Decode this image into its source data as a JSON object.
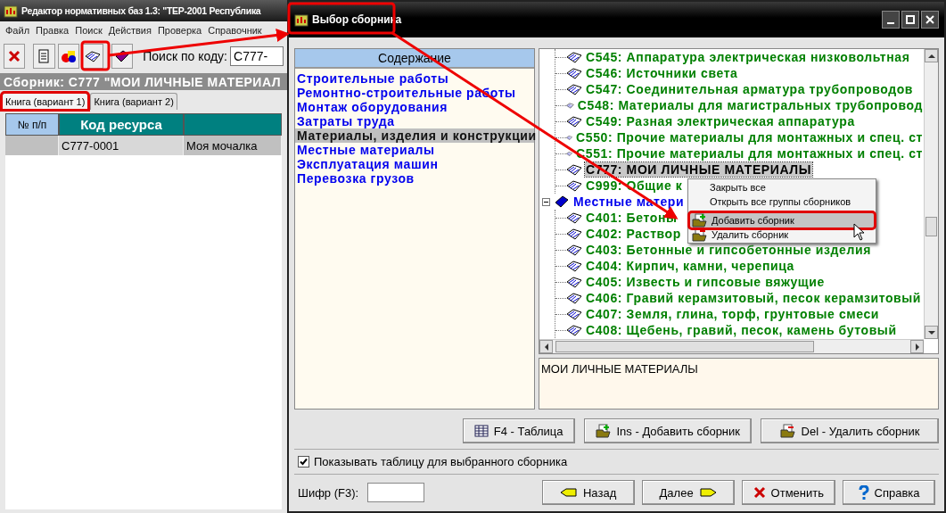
{
  "main_window": {
    "title": "Редактор нормативных баз 1.3: \"ТЕР-2001 Республика",
    "menu": [
      "Файл",
      "Правка",
      "Поиск",
      "Действия",
      "Проверка",
      "Справочник"
    ],
    "toolbar": {
      "search_label": "Поиск по коду:",
      "search_value": "С777-"
    },
    "header": "Сборник: С777 \"МОИ ЛИЧНЫЕ МАТЕРИАЛ",
    "tabs": [
      {
        "label": "Книга (вариант 1)",
        "selected": true
      },
      {
        "label": "Книга (вариант 2)",
        "selected": false
      }
    ],
    "table": {
      "columns": [
        "№ п/п",
        "Код ресурса",
        ""
      ],
      "rows": [
        {
          "cells": [
            "",
            "С777-0001",
            "Моя мочалка"
          ],
          "selected": true
        }
      ]
    }
  },
  "dialog": {
    "title": "Выбор сборника",
    "contents": {
      "heading": "Содержание",
      "items": [
        {
          "label": "Строительные работы",
          "selected": false
        },
        {
          "label": "Ремонтно-строительные работы",
          "selected": false
        },
        {
          "label": "Монтаж оборудования",
          "selected": false
        },
        {
          "label": "Затраты труда",
          "selected": false
        },
        {
          "label": "Материалы, изделия и конструкции",
          "selected": true
        },
        {
          "label": "Местные материалы",
          "selected": false
        },
        {
          "label": "Эксплуатация машин",
          "selected": false
        },
        {
          "label": "Перевозка грузов",
          "selected": false
        }
      ]
    },
    "tree": [
      {
        "children": [
          {
            "label": "С545: Аппаратура электрическая низковольтная",
            "selected": false
          },
          {
            "label": "С546: Источники света",
            "selected": false
          },
          {
            "label": "С547: Соединительная арматура трубопроводов",
            "selected": false
          },
          {
            "label": "С548: Материалы для магистральных трубопровод",
            "selected": false
          },
          {
            "label": "С549: Разная электрическая аппаратура",
            "selected": false
          },
          {
            "label": "С550: Прочие материалы для монтажных и спец. ст",
            "selected": false
          },
          {
            "label": "С551: Прочие материалы для монтажных и спец. ст",
            "selected": false
          },
          {
            "label": "С777: МОИ ЛИЧНЫЕ МАТЕРИАЛЫ",
            "selected": true
          },
          {
            "label": "С999: Общие к",
            "selected": false
          }
        ]
      },
      {
        "label": "Местные матери",
        "expanded": true,
        "children": [
          {
            "label": "С401: Бетоны",
            "selected": false
          },
          {
            "label": "С402: Раствор",
            "selected": false
          },
          {
            "label": "С403: Бетонные и гипсобетонные изделия",
            "selected": false
          },
          {
            "label": "С404: Кирпич, камни, черепица",
            "selected": false
          },
          {
            "label": "С405: Известь и гипсовые вяжущие",
            "selected": false
          },
          {
            "label": "С406: Гравий керамзитовый, песок керамзитовый",
            "selected": false
          },
          {
            "label": "С407: Земля, глина, торф, грунтовые смеси",
            "selected": false
          },
          {
            "label": "С408: Щебень, гравий, песок, камень бутовый",
            "selected": false
          }
        ]
      }
    ],
    "context_menu": [
      {
        "kind": "item",
        "label": "Закрыть все",
        "selected": false
      },
      {
        "kind": "item",
        "label": "Открыть все группы сборников",
        "selected": false
      },
      {
        "kind": "separator"
      },
      {
        "kind": "add",
        "label": "Добавить сборник",
        "selected": true
      },
      {
        "kind": "remove",
        "label": "Удалить сборник",
        "selected": false
      }
    ],
    "description": "МОИ ЛИЧНЫЕ МАТЕРИАЛЫ",
    "actions": [
      {
        "kind": "table",
        "label": "F4 - Таблица"
      },
      {
        "kind": "add",
        "label": "Ins - Добавить сборник"
      },
      {
        "kind": "remove",
        "label": "Del - Удалить сборник"
      }
    ],
    "show_table": {
      "label": "Показывать таблицу для выбранного сборника",
      "checked": true
    },
    "code_field": {
      "label": "Шифр (F3):"
    },
    "buttons": [
      {
        "kind": "back",
        "label": "Назад"
      },
      {
        "kind": "next",
        "label": "Далее"
      },
      {
        "kind": "cancel",
        "label": "Отменить"
      },
      {
        "kind": "help",
        "label": "Справка"
      }
    ]
  }
}
